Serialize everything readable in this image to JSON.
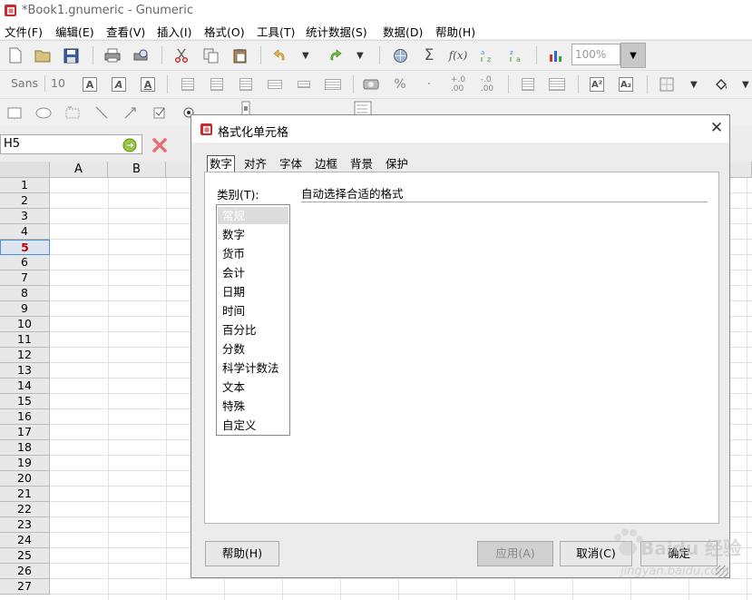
{
  "window": {
    "title": "*Book1.gnumeric - Gnumeric"
  },
  "menu": [
    "文件(F)",
    "编辑(E)",
    "查看(V)",
    "插入(I)",
    "格式(O)",
    "工具(T)",
    "统计数据(S)",
    "数据(D)",
    "帮助(H)"
  ],
  "toolbar": {
    "zoom": "100%",
    "font_name": "Sans",
    "font_size": "10"
  },
  "formula_bar": {
    "cell_ref": "H5"
  },
  "sheet": {
    "columns": [
      "A",
      "B"
    ],
    "rows": [
      "1",
      "2",
      "3",
      "4",
      "5",
      "6",
      "7",
      "8",
      "9",
      "10",
      "11",
      "12",
      "13",
      "14",
      "15",
      "16",
      "17",
      "18",
      "19",
      "20",
      "21",
      "22",
      "23",
      "24",
      "25",
      "26",
      "27"
    ],
    "active_row": "5"
  },
  "dialog": {
    "title": "格式化单元格",
    "tabs": [
      "数字",
      "对齐",
      "字体",
      "边框",
      "背景",
      "保护"
    ],
    "active_tab": "数字",
    "category_label": "类别(T):",
    "categories": [
      "常规",
      "数字",
      "货币",
      "会计",
      "日期",
      "时间",
      "百分比",
      "分数",
      "科学计数法",
      "文本",
      "特殊",
      "自定义"
    ],
    "selected_category": "常规",
    "format_description": "自动选择合适的格式",
    "buttons": {
      "help": "帮助(H)",
      "apply": "应用(A)",
      "cancel": "取消(C)",
      "ok": "确定"
    }
  },
  "watermark": {
    "text": "Baidu 经验",
    "url": "jingyan.baidu.com"
  },
  "icons": [
    "new-icon",
    "open-icon",
    "save-icon",
    "print-icon",
    "print-preview-icon",
    "cut-icon",
    "copy-icon",
    "paste-icon",
    "undo-icon",
    "redo-icon",
    "hyperlink-icon",
    "sum-icon",
    "function-icon",
    "sort-ascending-icon",
    "sort-descending-icon",
    "chart-icon"
  ]
}
